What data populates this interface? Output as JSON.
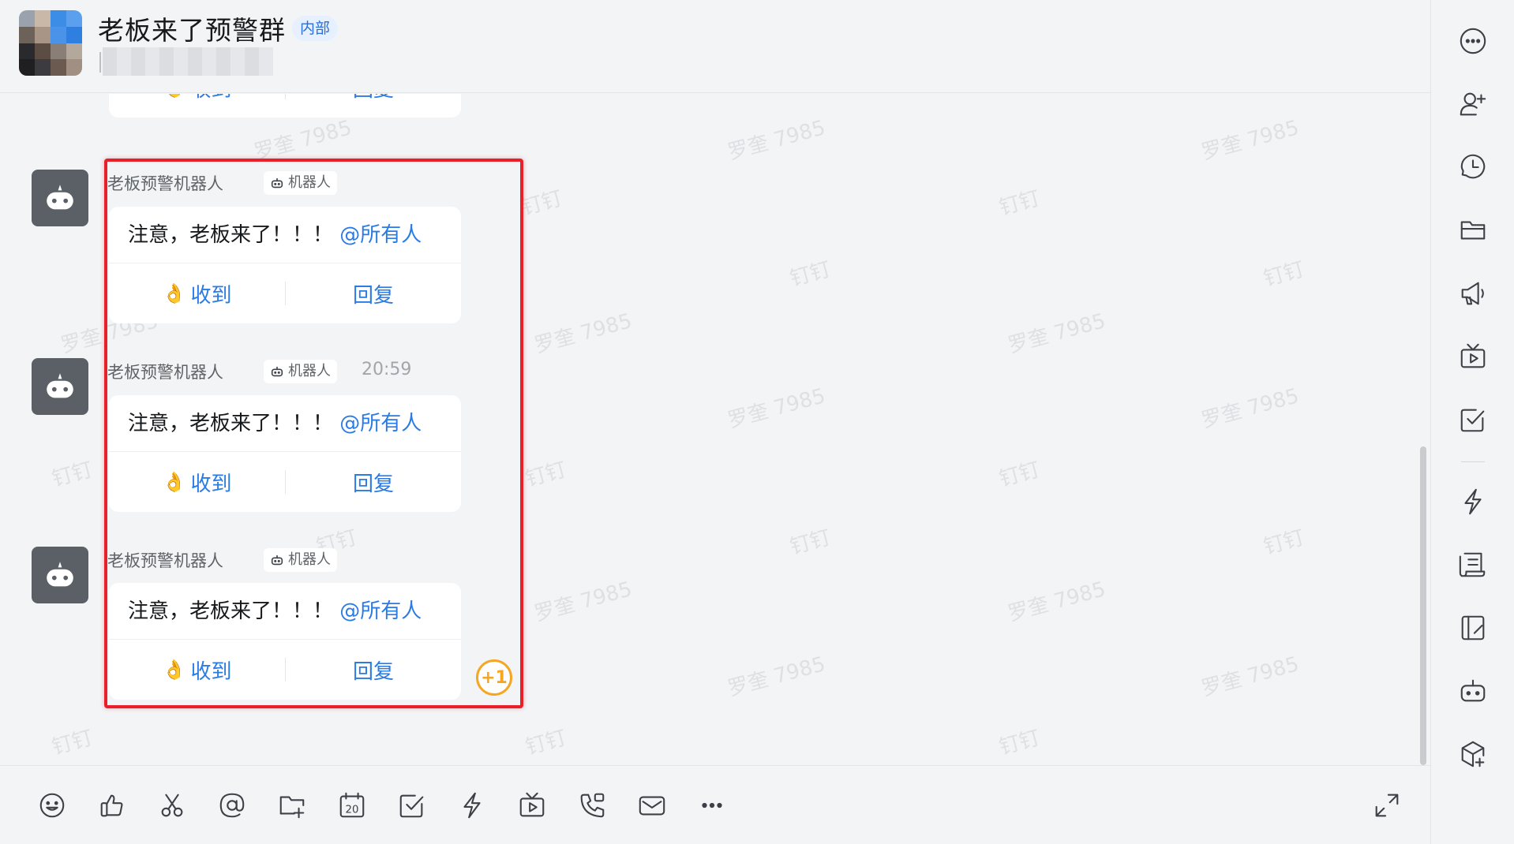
{
  "header": {
    "title": "老板来了预警群",
    "badge": "内部"
  },
  "watermarks": {
    "name": "罗奎 7985",
    "app": "钉钉"
  },
  "top_card": {
    "receive_label": "收到",
    "reply_label": "回复"
  },
  "messages": [
    {
      "sender": "老板预警机器人",
      "robot_tag": "机器人",
      "time": "",
      "text": "注意，老板来了！！！",
      "mention": "@所有人",
      "receive_label": "收到",
      "reply_label": "回复"
    },
    {
      "sender": "老板预警机器人",
      "robot_tag": "机器人",
      "time": "20:59",
      "text": "注意，老板来了！！！",
      "mention": "@所有人",
      "receive_label": "收到",
      "reply_label": "回复"
    },
    {
      "sender": "老板预警机器人",
      "robot_tag": "机器人",
      "time": "",
      "text": "注意，老板来了！！！",
      "mention": "@所有人",
      "receive_label": "收到",
      "reply_label": "回复"
    }
  ],
  "reaction": "+1",
  "toolbar_icons": [
    "emoji-icon",
    "thumbs-up-icon",
    "scissors-icon",
    "at-icon",
    "folder-add-icon",
    "calendar-icon",
    "checkbox-icon",
    "lightning-icon",
    "video-icon",
    "phone-icon",
    "mail-icon",
    "more-icon",
    "expand-icon"
  ],
  "calendar_day": "20",
  "right_bar_icons": [
    "more-options-icon",
    "add-member-icon",
    "history-icon",
    "folder-icon",
    "announcement-icon",
    "live-icon",
    "todo-icon",
    "lightning-icon",
    "document-icon",
    "notes-icon",
    "robot-icon",
    "app-cube-icon"
  ],
  "colors": {
    "accent": "#2a7be4",
    "highlight": "#e8202a",
    "reaction": "#f5a623",
    "background": "#f3f4f6"
  }
}
